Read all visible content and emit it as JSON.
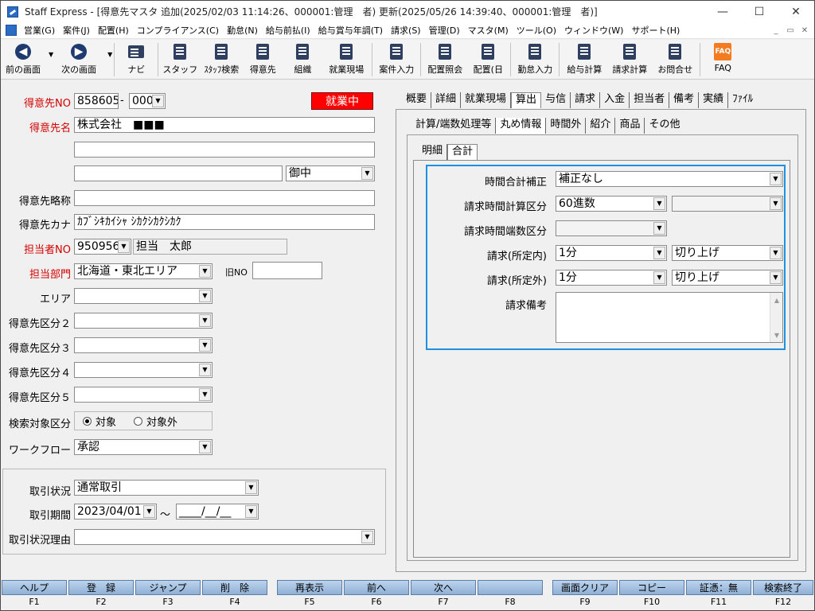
{
  "window": {
    "title": "Staff Express - [得意先マスタ 追加(2025/02/03 11:14:26、000001:管理　者) 更新(2025/05/26 14:39:40、000001:管理　者)]",
    "minimize": "—",
    "maximize": "☐",
    "close": "✕"
  },
  "menu": {
    "items": [
      "営業(G)",
      "案件(J)",
      "配置(H)",
      "コンプライアンス(C)",
      "勤怠(N)",
      "給与前払(I)",
      "給与賞与年調(T)",
      "請求(S)",
      "管理(D)",
      "マスタ(M)",
      "ツール(O)",
      "ウィンドウ(W)",
      "サポート(H)"
    ],
    "mdi": [
      "_",
      "▭",
      "✕"
    ]
  },
  "toolbar": {
    "back": "前の画面",
    "forward": "次の画面",
    "navi": "ナビ",
    "staff": "スタッフ",
    "staff_search": "ｽﾀｯﾌ検索",
    "client": "得意先",
    "org": "組織",
    "site": "就業現場",
    "case_input": "案件入力",
    "assign_inquiry": "配置照会",
    "assign_day": "配置(日",
    "attendance_input": "勤怠入力",
    "payroll": "給与計算",
    "billing": "請求計算",
    "inquiry": "お問合せ",
    "faq": "FAQ",
    "faq_icon_text": "FAQ"
  },
  "form": {
    "client_no_label": "得意先NO",
    "client_no": "858605",
    "client_no_sep": "-",
    "client_no_branch": "000",
    "status": "就業中",
    "client_name_label": "得意先名",
    "client_name": "株式会社　■■■",
    "address_line2": "",
    "address_line3": "",
    "honorific": "御中",
    "short_name_label": "得意先略称",
    "short_name": "",
    "kana_label": "得意先カナ",
    "kana": "ｶﾌﾞｼｷｶｲｼｬ ｼｶｸｼｶｸｼｶｸ",
    "person_no_label": "担当者NO",
    "person_no": "950956",
    "person_name": "担当　太郎",
    "dept_label": "担当部門",
    "dept": "北海道・東北エリア",
    "old_no_label": "旧NO",
    "old_no": "",
    "area_label": "エリア",
    "area": "",
    "cat2_label": "得意先区分２",
    "cat2": "",
    "cat3_label": "得意先区分３",
    "cat3": "",
    "cat4_label": "得意先区分４",
    "cat4": "",
    "cat5_label": "得意先区分５",
    "cat5": "",
    "search_target_label": "検索対象区分",
    "search_target_on": "対象",
    "search_target_off": "対象外",
    "workflow_label": "ワークフロー",
    "workflow": "承認",
    "trade_status_label": "取引状況",
    "trade_status": "通常取引",
    "trade_period_label": "取引期間",
    "trade_start": "2023/04/01",
    "trade_tilde": "～",
    "trade_end": "____/__/__",
    "trade_reason_label": "取引状況理由",
    "trade_reason": ""
  },
  "tabs_main": [
    "概要",
    "詳細",
    "就業現場",
    "算出",
    "与信",
    "請求",
    "入金",
    "担当者",
    "備考",
    "実績",
    "ﾌｧｲﾙ"
  ],
  "tabs_sub": [
    "計算/端数処理等",
    "丸め情報",
    "時間外",
    "紹介",
    "商品",
    "その他"
  ],
  "tabs_sub2": [
    "明細",
    "合計"
  ],
  "rounding": {
    "time_total_label": "時間合計補正",
    "time_total": "補正なし",
    "calc_label": "請求時間計算区分",
    "calc": "60進数",
    "calc2": "",
    "fraction_label": "請求時間端数区分",
    "fraction": "",
    "in_label": "請求(所定内)",
    "in_unit": "1分",
    "in_method": "切り上げ",
    "out_label": "請求(所定外)",
    "out_unit": "1分",
    "out_method": "切り上げ",
    "note_label": "請求備考",
    "note": ""
  },
  "fkeys": [
    {
      "label": "ヘルプ",
      "key": "F1"
    },
    {
      "label": "登　録",
      "key": "F2"
    },
    {
      "label": "ジャンプ",
      "key": "F3"
    },
    {
      "label": "削　除",
      "key": "F4"
    },
    {
      "label": "再表示",
      "key": "F5"
    },
    {
      "label": "前へ",
      "key": "F6"
    },
    {
      "label": "次へ",
      "key": "F7"
    },
    {
      "label": "",
      "key": "F8"
    },
    {
      "label": "画面クリア",
      "key": "F9"
    },
    {
      "label": "コピー",
      "key": "F10"
    },
    {
      "label": "証憑：無",
      "key": "F11"
    },
    {
      "label": "検索終了",
      "key": "F12"
    }
  ],
  "colors": {
    "status_bg": "#ff0000",
    "highlight_border": "#1e90e0",
    "required_label": "#d40000",
    "fkey_bg": "#a9c4e4"
  }
}
